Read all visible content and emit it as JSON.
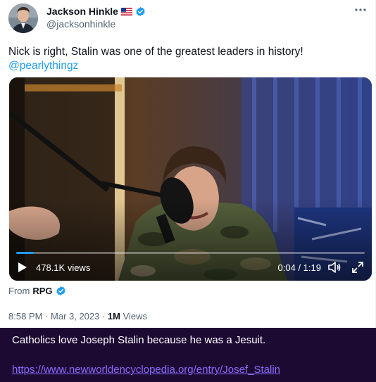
{
  "tweet": {
    "display_name": "Jackson Hinkle",
    "handle": "@jacksonhinkle",
    "text": "Nick is right, Stalin was one of the greatest leaders in history!",
    "mention": "@pearlythingz",
    "icons": {
      "flag": "us-flag-icon",
      "verified": "verified-badge-icon",
      "more": "more-options-icon"
    },
    "colors": {
      "accent": "#1d9bf0",
      "text": "#0f1419",
      "secondary": "#536471"
    }
  },
  "video": {
    "views": "478.1K views",
    "time": "0:04 / 1:19",
    "progress": 0.05,
    "icons": {
      "play": "play-icon",
      "volume": "volume-icon",
      "fullscreen": "fullscreen-icon"
    }
  },
  "source": {
    "prefix": "From",
    "name": "RPG"
  },
  "meta": {
    "time": "8:58 PM",
    "separator": " · ",
    "date": "Mar 3, 2023",
    "views_count": "1M",
    "views_label": "Views"
  },
  "note": {
    "text": "Catholics love Joseph Stalin because he was a Jesuit.",
    "link": "https://www.newworldencyclopedia.org/entry/Josef_Stalin",
    "colors": {
      "background": "#1d0a33",
      "link": "#8c6bff"
    }
  }
}
